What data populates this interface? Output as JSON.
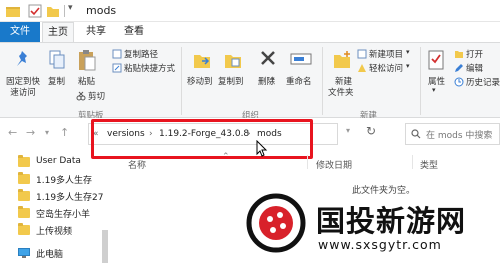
{
  "window": {
    "title": "mods"
  },
  "tabs": {
    "file": "文件",
    "home": "主页",
    "share": "共享",
    "view": "查看"
  },
  "ribbon": {
    "pin_quick_access": [
      "固定到快",
      "速访问"
    ],
    "copy": "复制",
    "paste": "粘贴",
    "copy_path": "复制路径",
    "paste_shortcut": "粘贴快捷方式",
    "cut": "剪切",
    "clipboard_group": "剪贴板",
    "move_to": "移动到",
    "copy_to": "复制到",
    "delete": "删除",
    "rename": "重命名",
    "organize_group": "组织",
    "new_item": "新建项目",
    "easy_access": "轻松访问",
    "new_folder": [
      "新建",
      "文件夹"
    ],
    "new_group": "新建",
    "properties": "属性",
    "open": "打开",
    "edit": "编辑",
    "history": "历史记录"
  },
  "address": {
    "crumbs": [
      "versions",
      "1.19.2-Forge_43.0.8",
      "mods"
    ],
    "search_placeholder": "在 mods 中搜索"
  },
  "tree": {
    "items": [
      "User Data",
      "1.19多人生存",
      "1.19多人生存27",
      "空岛生存小羊",
      "上传视频",
      "此电脑"
    ]
  },
  "columns": {
    "name": "名称",
    "modified": "修改日期",
    "type": "类型"
  },
  "empty_message": "此文件夹为空。",
  "watermark": {
    "text": "国投新游网",
    "url": "www.sxsgytr.com"
  },
  "colors": {
    "accent": "#1979ca",
    "highlight": "#e8141f",
    "folder": "#f2c94c"
  }
}
